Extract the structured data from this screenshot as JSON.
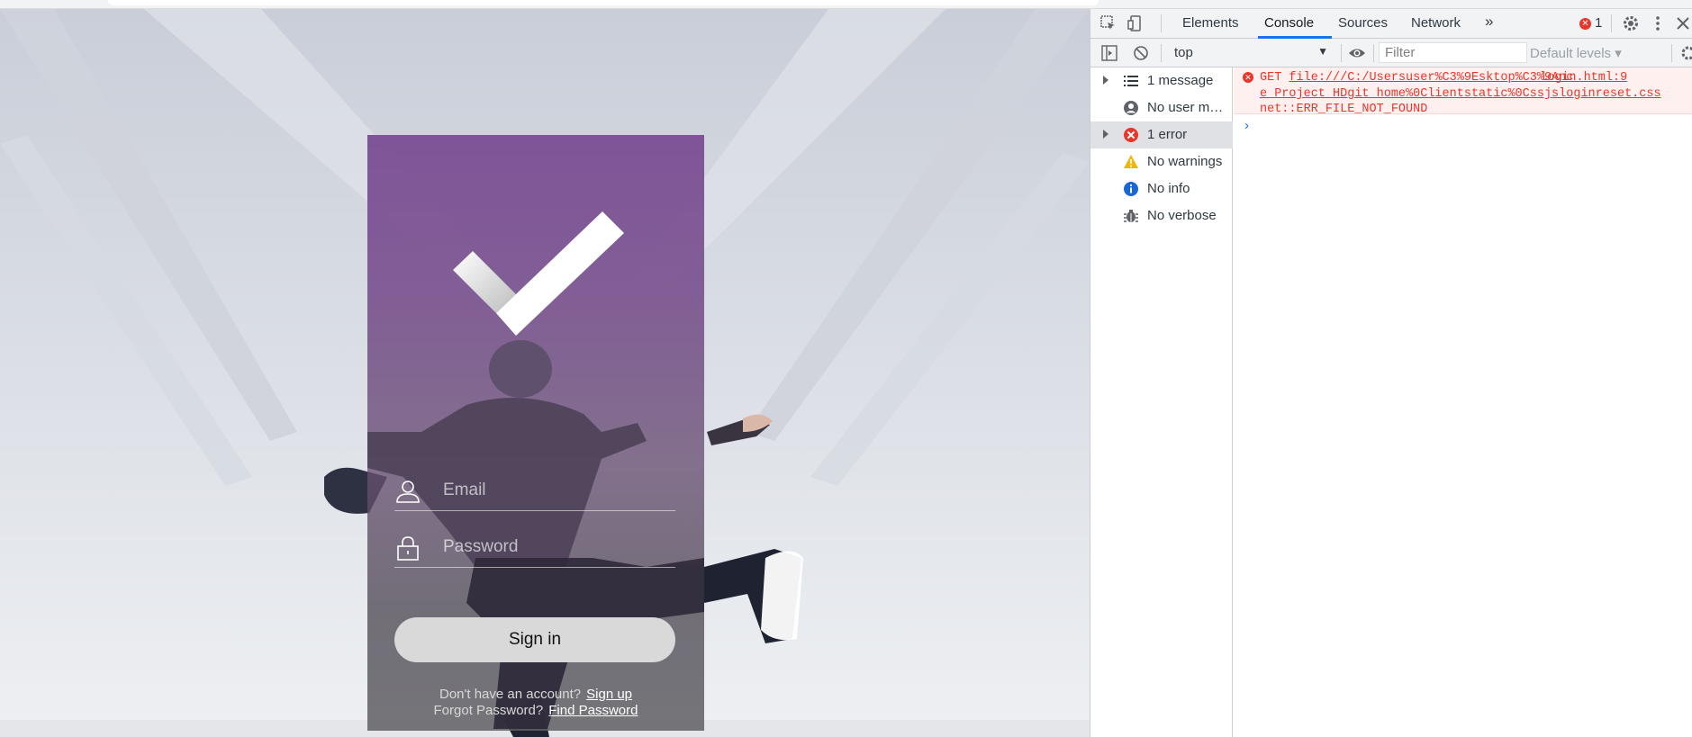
{
  "login": {
    "email_placeholder": "Email",
    "password_placeholder": "Password",
    "signin_label": "Sign in",
    "signup_prompt": "Don't have an account?",
    "signup_link": "Sign up",
    "forgot_prompt": "Forgot Password?",
    "find_link": "Find Password"
  },
  "devtools": {
    "tabs": [
      "Elements",
      "Console",
      "Sources",
      "Network"
    ],
    "more_tabs": "»",
    "error_count": "1",
    "context": "top",
    "filter_placeholder": "Filter",
    "levels": "Default levels ▾",
    "sidebar": [
      {
        "label": "1 message",
        "icon": "list-icon"
      },
      {
        "label": "No user messages",
        "icon": "user-icon"
      },
      {
        "label": "1 error",
        "icon": "error-icon"
      },
      {
        "label": "No warnings",
        "icon": "warning-icon"
      },
      {
        "label": "No info",
        "icon": "info-icon"
      },
      {
        "label": "No verbose",
        "icon": "bug-icon"
      }
    ],
    "console": {
      "method": "GET",
      "url_line1": "file:///C:/Usersuser%C3%9Esktop%C3%9Anc",
      "url_line2": "e_Project_HDgit_home%0Clientstatic%0Cssjsloginreset.css",
      "error_text": "net::ERR_FILE_NOT_FOUND",
      "source": "login.html:9"
    },
    "colors": {
      "error": "#e8362a",
      "accent": "#1a73e8"
    }
  }
}
